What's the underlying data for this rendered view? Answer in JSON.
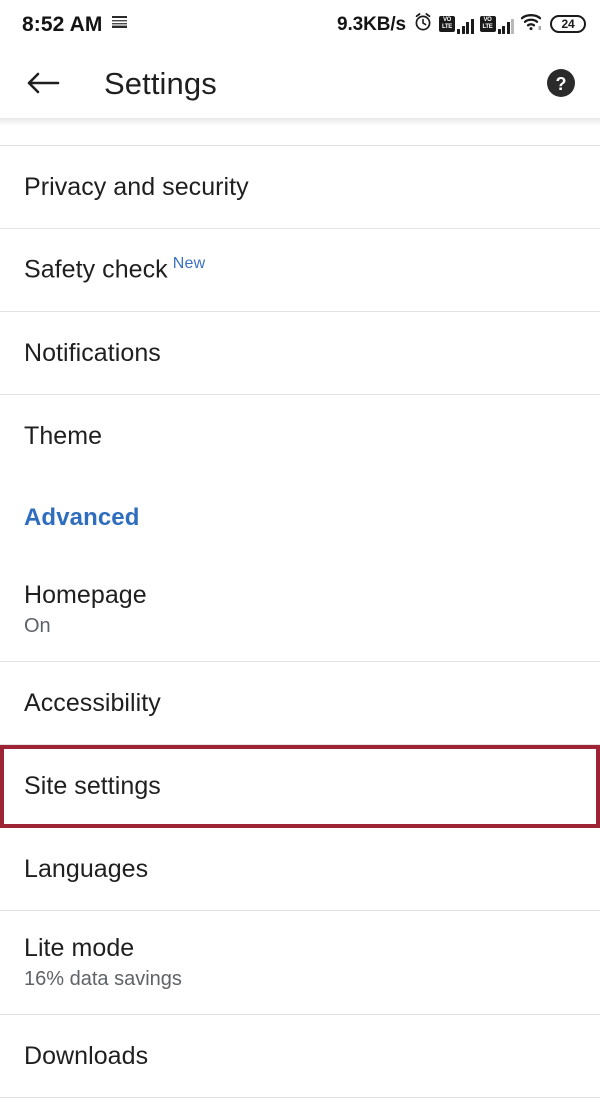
{
  "status_bar": {
    "time": "8:52 AM",
    "left_icon": "keyboard-icon",
    "network_speed": "9.3KB/s",
    "alarm_icon": "alarm-clock-icon",
    "sim1": {
      "badge": "VoLTE",
      "bars": 4
    },
    "sim2": {
      "badge": "VoLTE",
      "bars": 3
    },
    "wifi_icon": "wifi-icon",
    "battery_level": "24"
  },
  "toolbar": {
    "back_icon": "back-arrow-icon",
    "title": "Settings",
    "help_icon": "help-circle-icon"
  },
  "colors": {
    "accent_blue": "#2f6dbf",
    "badge_blue": "#3b72c0",
    "highlight_red": "#9d2335",
    "text_primary": "#1f1f1f",
    "text_secondary": "#5f6368",
    "divider": "#e4e4e4",
    "background": "#ffffff"
  },
  "settings_list": [
    {
      "type": "item",
      "name": "privacy-and-security",
      "title": "Privacy and security",
      "subtitle": null,
      "badge": null,
      "highlighted": false
    },
    {
      "type": "item",
      "name": "safety-check",
      "title": "Safety check",
      "subtitle": null,
      "badge": "New",
      "highlighted": false
    },
    {
      "type": "item",
      "name": "notifications",
      "title": "Notifications",
      "subtitle": null,
      "badge": null,
      "highlighted": false
    },
    {
      "type": "item",
      "name": "theme",
      "title": "Theme",
      "subtitle": null,
      "badge": null,
      "highlighted": false,
      "no_divider": true
    },
    {
      "type": "section",
      "name": "advanced",
      "title": "Advanced"
    },
    {
      "type": "item",
      "name": "homepage",
      "title": "Homepage",
      "subtitle": "On",
      "badge": null,
      "highlighted": false
    },
    {
      "type": "item",
      "name": "accessibility",
      "title": "Accessibility",
      "subtitle": null,
      "badge": null,
      "highlighted": false
    },
    {
      "type": "item",
      "name": "site-settings",
      "title": "Site settings",
      "subtitle": null,
      "badge": null,
      "highlighted": true
    },
    {
      "type": "item",
      "name": "languages",
      "title": "Languages",
      "subtitle": null,
      "badge": null,
      "highlighted": false
    },
    {
      "type": "item",
      "name": "lite-mode",
      "title": "Lite mode",
      "subtitle": "16% data savings",
      "badge": null,
      "highlighted": false
    },
    {
      "type": "item",
      "name": "downloads",
      "title": "Downloads",
      "subtitle": null,
      "badge": null,
      "highlighted": false
    }
  ]
}
